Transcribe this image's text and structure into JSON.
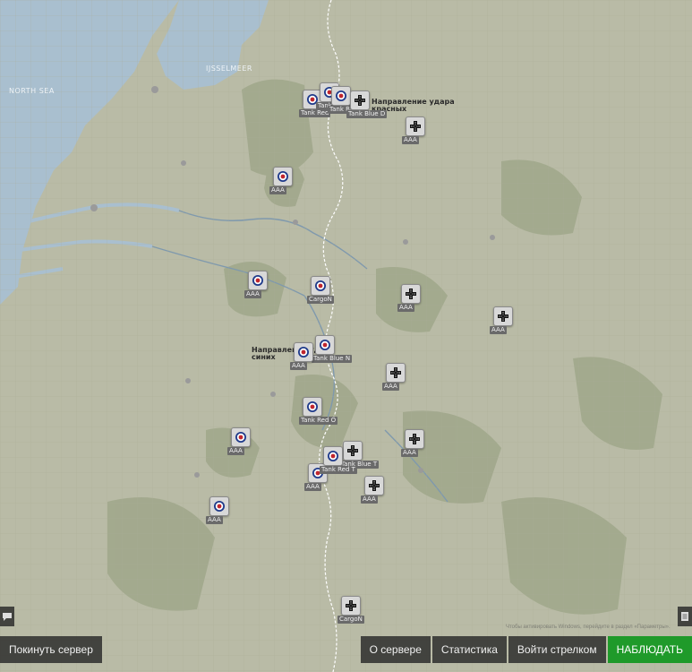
{
  "map": {
    "sea_labels": [
      {
        "text": "NORTH SEA"
      },
      {
        "text": "IJSSELMEER"
      }
    ],
    "annotations": [
      {
        "text": "Направление удара\nкрасных"
      },
      {
        "text": "Направление удара\nсиних"
      }
    ],
    "units": [
      {
        "side": "allied",
        "label": "Tank Red"
      },
      {
        "side": "allied",
        "label": "Tank Blue"
      },
      {
        "side": "allied",
        "label": "Tank Blue"
      },
      {
        "side": "axis",
        "label": "Tank Blue D"
      },
      {
        "side": "axis",
        "label": "AAA"
      },
      {
        "side": "allied",
        "label": "AAA"
      },
      {
        "side": "allied",
        "label": "AAA"
      },
      {
        "side": "allied",
        "label": "CargoN"
      },
      {
        "side": "axis",
        "label": "AAA"
      },
      {
        "side": "axis",
        "label": "AAA"
      },
      {
        "side": "allied",
        "label": "Tank Blue N"
      },
      {
        "side": "axis",
        "label": "AAA"
      },
      {
        "side": "allied",
        "label": "AAA"
      },
      {
        "side": "allied",
        "label": "Tank Red O"
      },
      {
        "side": "axis",
        "label": "Tank Blue T"
      },
      {
        "side": "axis",
        "label": "AAA"
      },
      {
        "side": "allied",
        "label": "AAA"
      },
      {
        "side": "allied",
        "label": "AAA"
      },
      {
        "side": "allied",
        "label": "Tank Red T"
      },
      {
        "side": "axis",
        "label": "AAA"
      },
      {
        "side": "allied",
        "label": "AAA"
      },
      {
        "side": "axis",
        "label": "CargoN"
      }
    ]
  },
  "watermark": "Чтобы активировать Windows, перейдите в раздел «Параметры».",
  "buttons": {
    "leave": "Покинуть сервер",
    "about": "О сервере",
    "stats": "Статистика",
    "gunner": "Войти стрелком",
    "observe": "НАБЛЮДАТЬ"
  },
  "colors": {
    "land": "#b9bba6",
    "sea": "#a9bfcf",
    "forest": "#9ea48a",
    "river": "#7f99ad",
    "front_line": "#ffffff",
    "observe_button": "#1f9a2a"
  }
}
